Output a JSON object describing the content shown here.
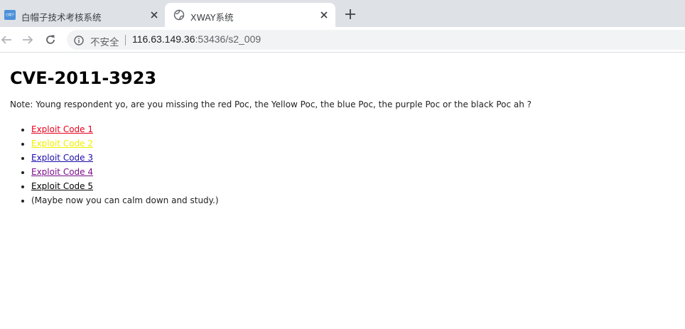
{
  "browser": {
    "tabs": [
      {
        "title": "白帽子技术考核系统",
        "favicon_text": "白帽子",
        "active": false
      },
      {
        "title": "XWAY系统",
        "active": true
      }
    ],
    "address_bar": {
      "security_label": "不安全",
      "url_host": "116.63.149.36",
      "url_rest": ":53436/s2_009"
    }
  },
  "page": {
    "title": "CVE-2011-3923",
    "note": "Note: Young respondent yo, are you missing the red Poc, the Yellow Poc, the blue Poc, the purple Poc or the black Poc ah ?",
    "links": [
      {
        "label": "Exploit Code 1",
        "color": "#e8001c"
      },
      {
        "label": "Exploit Code 2",
        "color": "#f0f000"
      },
      {
        "label": "Exploit Code 3",
        "color": "#1a0dab"
      },
      {
        "label": "Exploit Code 4",
        "color": "#7a0d8a"
      },
      {
        "label": "Exploit Code 5",
        "color": "#000000"
      }
    ],
    "footer_item": "(Maybe now you can calm down and study.)"
  }
}
